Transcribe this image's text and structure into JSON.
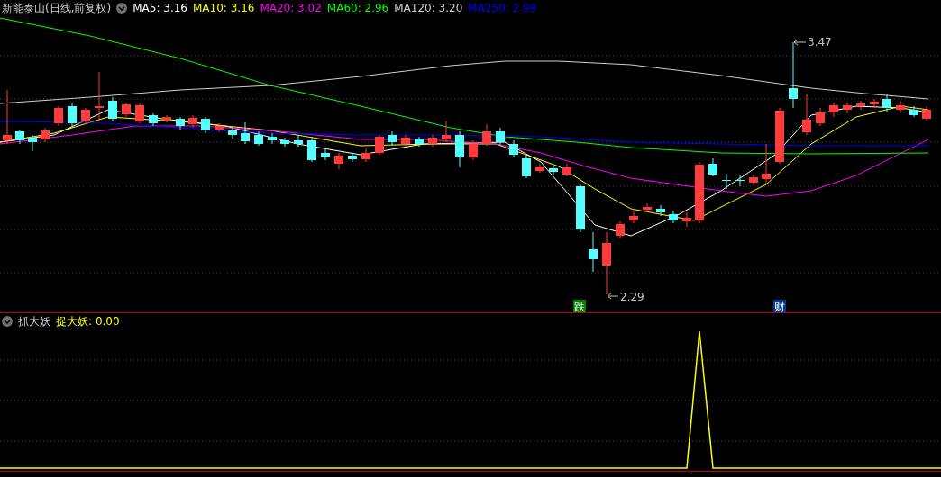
{
  "main_chart": {
    "title": "新能泰山(日线,前复权)",
    "moving_averages": [
      {
        "label": "MA5:",
        "value": "3.16",
        "color": "#ffffff"
      },
      {
        "label": "MA10:",
        "value": "3.16",
        "color": "#ffff00"
      },
      {
        "label": "MA20:",
        "value": "3.02",
        "color": "#ff00ff"
      },
      {
        "label": "MA60:",
        "value": "2.96",
        "color": "#00ff00"
      },
      {
        "label": "MA120:",
        "value": "3.20",
        "color": "#d0d0d0"
      },
      {
        "label": "MA250:",
        "value": "2.99",
        "color": "#0000ff"
      }
    ],
    "high_marker": "3.47",
    "low_marker": "2.29",
    "badges": [
      {
        "text": "跌",
        "color": "#008000"
      },
      {
        "text": "财",
        "color": "#003c8c"
      }
    ]
  },
  "indicator": {
    "name": "抓大妖",
    "series": [
      {
        "label": "捉大妖:",
        "value": "0.00",
        "color": "#ffff00"
      }
    ]
  }
}
